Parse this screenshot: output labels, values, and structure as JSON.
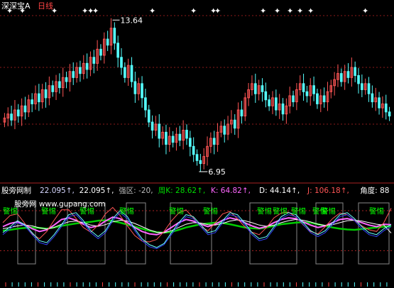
{
  "chart_data": [
    {
      "type": "candlestick",
      "title": "深深宝A 日线",
      "stock_name": "深深宝A",
      "period": "日线",
      "annotations": [
        {
          "label": "13.64",
          "kind": "high"
        },
        {
          "label": "6.95",
          "kind": "low"
        }
      ],
      "ylim": [
        6.2,
        14.4
      ],
      "signal_marker": "✦",
      "grid": "horizontal dashed red lines",
      "colors": {
        "up": "#ff5555",
        "down": "#55ffff",
        "grid": "#8b1a1a",
        "marker": "#ffffff"
      },
      "series": {
        "close": [
          9.2,
          9.4,
          9.1,
          9.6,
          9.3,
          9.8,
          9.5,
          10.1,
          9.9,
          10.4,
          10.0,
          10.6,
          10.2,
          10.8,
          10.5,
          11.0,
          10.7,
          11.2,
          11.0,
          11.5,
          11.2,
          11.7,
          11.4,
          11.9,
          11.6,
          12.2,
          11.9,
          12.6,
          12.3,
          13.1,
          12.8,
          13.64,
          12.9,
          12.2,
          11.7,
          11.2,
          11.8,
          11.0,
          10.4,
          10.9,
          10.2,
          9.6,
          9.0,
          8.6,
          8.9,
          8.2,
          8.5,
          7.9,
          8.3,
          8.0,
          8.4,
          8.1,
          8.6,
          8.2,
          7.8,
          7.4,
          7.1,
          6.95,
          7.3,
          7.8,
          8.2,
          7.9,
          8.5,
          8.8,
          8.4,
          8.9,
          9.1,
          8.7,
          9.6,
          9.3,
          10.2,
          10.6,
          10.9,
          10.4,
          10.8,
          10.5,
          10.1,
          9.8,
          10.2,
          9.6,
          9.9,
          9.4,
          9.8,
          10.3,
          10.0,
          10.6,
          10.9,
          10.5,
          10.3,
          10.8,
          10.4,
          9.9,
          10.3,
          10.0,
          10.5,
          10.8,
          11.1,
          11.4,
          11.0,
          11.5,
          11.2,
          11.7,
          11.3,
          10.9,
          10.6,
          10.9,
          10.4,
          10.0,
          10.2,
          9.7,
          9.9,
          9.5,
          9.3
        ]
      }
    },
    {
      "type": "line",
      "title": "股旁网制",
      "values_header": [
        {
          "text": "22.095↑,",
          "color": "#d7d7ff"
        },
        {
          "text": "22.095↑,",
          "color": "#ffffff"
        },
        {
          "text": "强区: -20,",
          "color": "#bbbbbb"
        },
        {
          "text": "周K: 28.62↑,",
          "color": "#00dd00"
        },
        {
          "text": "K: 64.82↑,",
          "color": "#ff66ff"
        },
        {
          "text": "D: 44.14↑,",
          "color": "#ffffff"
        },
        {
          "text": "J: 106.18↑,",
          "color": "#ff5555"
        },
        {
          "text": "角度: 88",
          "color": "#ffffff"
        }
      ],
      "watermark": "股旁网 www.gupang.com",
      "signal_label": "警惕",
      "signal_count": 14,
      "ylim": [
        -40,
        130
      ],
      "series": [
        {
          "name": "周K",
          "color": "#00cc00",
          "values": [
            50,
            52,
            55,
            57,
            58,
            57,
            55,
            58,
            62,
            65,
            68,
            70,
            72,
            75,
            76,
            74,
            70,
            65,
            60,
            55,
            50,
            46,
            45,
            47,
            52,
            58,
            62,
            66,
            68,
            70,
            69,
            66,
            62,
            58,
            56,
            55,
            58,
            62,
            66,
            68,
            70,
            71,
            70,
            66,
            62,
            58,
            55,
            53,
            52,
            54,
            56,
            58,
            60,
            61
          ]
        },
        {
          "name": "K",
          "color": "#ff66ff",
          "values": [
            60,
            68,
            72,
            65,
            55,
            48,
            52,
            64,
            78,
            82,
            76,
            66,
            58,
            62,
            74,
            84,
            80,
            70,
            58,
            48,
            42,
            40,
            46,
            58,
            70,
            78,
            74,
            66,
            60,
            66,
            76,
            82,
            78,
            70,
            62,
            56,
            60,
            70,
            78,
            82,
            80,
            72,
            64,
            58,
            62,
            70,
            78,
            80,
            76,
            70,
            64,
            60,
            66,
            64.82
          ]
        },
        {
          "name": "D",
          "color": "#ffffff",
          "values": [
            55,
            58,
            62,
            64,
            62,
            57,
            54,
            58,
            66,
            72,
            74,
            70,
            64,
            61,
            65,
            72,
            76,
            74,
            68,
            60,
            52,
            46,
            45,
            50,
            58,
            66,
            70,
            69,
            65,
            64,
            68,
            74,
            77,
            75,
            70,
            64,
            61,
            64,
            70,
            75,
            78,
            76,
            72,
            66,
            63,
            65,
            70,
            75,
            76,
            74,
            70,
            66,
            64,
            44.14
          ]
        },
        {
          "name": "J",
          "color": "#ff5555",
          "values": [
            70,
            88,
            92,
            68,
            42,
            30,
            48,
            76,
            102,
            102,
            80,
            58,
            46,
            64,
            92,
            108,
            88,
            62,
            38,
            24,
            22,
            28,
            48,
            74,
            94,
            102,
            82,
            60,
            50,
            70,
            92,
            98,
            80,
            60,
            46,
            40,
            58,
            82,
            94,
            96,
            84,
            64,
            48,
            42,
            60,
            80,
            94,
            90,
            76,
            62,
            52,
            48,
            70,
            106.18
          ]
        },
        {
          "name": "",
          "color": "#3344ff",
          "values": [
            40,
            55,
            70,
            62,
            40,
            20,
            15,
            35,
            60,
            85,
            90,
            70,
            45,
            30,
            45,
            75,
            95,
            80,
            50,
            25,
            10,
            5,
            15,
            40,
            65,
            85,
            80,
            60,
            40,
            45,
            70,
            90,
            85,
            65,
            40,
            25,
            30,
            55,
            80,
            90,
            85,
            65,
            45,
            35,
            45,
            65,
            85,
            90,
            75,
            55,
            40,
            35,
            50,
            60
          ]
        },
        {
          "name": "",
          "color": "#66ffff",
          "values": [
            45,
            60,
            75,
            65,
            45,
            25,
            20,
            40,
            65,
            90,
            95,
            75,
            50,
            35,
            50,
            80,
            100,
            85,
            55,
            30,
            15,
            8,
            18,
            45,
            70,
            90,
            85,
            65,
            45,
            50,
            75,
            95,
            90,
            70,
            45,
            30,
            35,
            60,
            85,
            95,
            90,
            70,
            50,
            40,
            50,
            70,
            90,
            95,
            80,
            60,
            45,
            40,
            55,
            65
          ]
        }
      ]
    }
  ]
}
